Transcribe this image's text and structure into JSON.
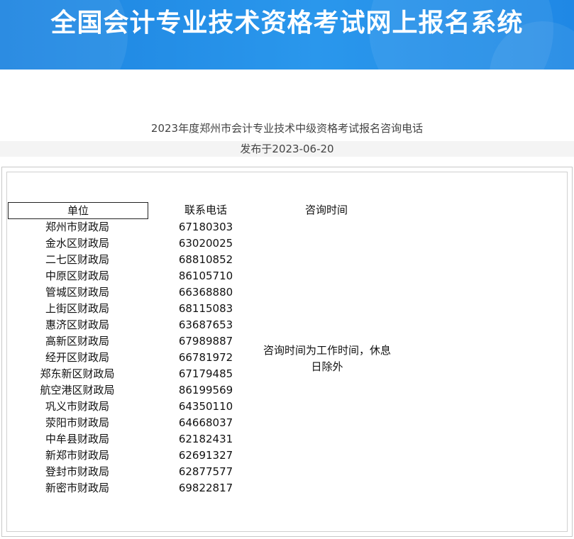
{
  "header": {
    "title": "全国会计专业技术资格考试网上报名系统",
    "bg_color": "#1f8ce6"
  },
  "article": {
    "title": "2023年度郑州市会计专业技术中级资格考试报名咨询电话",
    "published": "发布于2023-06-20"
  },
  "table": {
    "headers": {
      "unit": "单位",
      "phone": "联系电话",
      "time": "咨询时间"
    },
    "rows": [
      {
        "unit": "郑州市财政局",
        "phone": "67180303"
      },
      {
        "unit": "金水区财政局",
        "phone": "63020025"
      },
      {
        "unit": "二七区财政局",
        "phone": "68810852"
      },
      {
        "unit": "中原区财政局",
        "phone": "86105710"
      },
      {
        "unit": "管城区财政局",
        "phone": "66368880"
      },
      {
        "unit": "上街区财政局",
        "phone": "68115083"
      },
      {
        "unit": "惠济区财政局",
        "phone": "63687653"
      },
      {
        "unit": "高新区财政局",
        "phone": "67989887"
      },
      {
        "unit": "经开区财政局",
        "phone": "66781972"
      },
      {
        "unit": "郑东新区财政局",
        "phone": "67179485"
      },
      {
        "unit": "航空港区财政局",
        "phone": "86199569"
      },
      {
        "unit": "巩义市财政局",
        "phone": "64350110"
      },
      {
        "unit": "荥阳市财政局",
        "phone": "64668037"
      },
      {
        "unit": "中牟县财政局",
        "phone": "62182431"
      },
      {
        "unit": "新郑市财政局",
        "phone": "62691327"
      },
      {
        "unit": "登封市财政局",
        "phone": "62877577"
      },
      {
        "unit": "新密市财政局",
        "phone": "69822817"
      }
    ],
    "time_note": "咨询时间为工作时间，休息日除外"
  }
}
